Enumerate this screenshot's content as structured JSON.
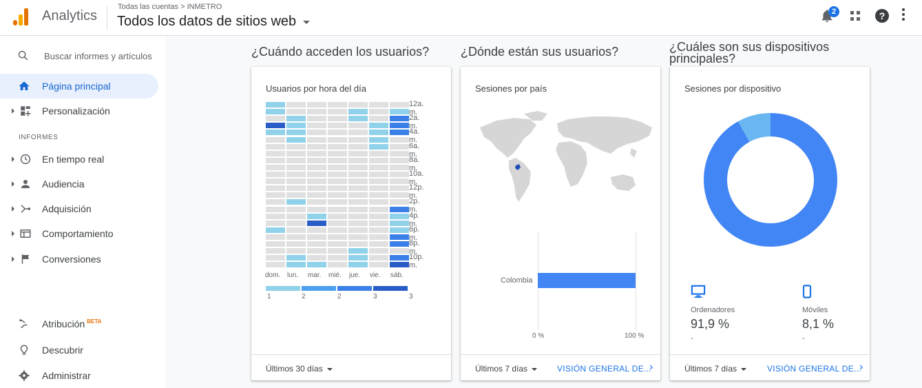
{
  "header": {
    "app_name": "Analytics",
    "breadcrumb": "Todas las cuentas > INMETRO",
    "view_title": "Todos los datos de sitios web",
    "notifications_count": "2"
  },
  "sidebar": {
    "search_placeholder": "Buscar informes y artículos",
    "home": "Página principal",
    "custom": "Personalización",
    "section_reports": "INFORMES",
    "items": [
      {
        "label": "En tiempo real",
        "icon": "clock-icon"
      },
      {
        "label": "Audiencia",
        "icon": "person-icon"
      },
      {
        "label": "Adquisición",
        "icon": "acquisition-icon"
      },
      {
        "label": "Comportamiento",
        "icon": "behavior-icon"
      },
      {
        "label": "Conversiones",
        "icon": "flag-icon"
      }
    ],
    "attribution": "Atribución",
    "attribution_badge": "BETA",
    "discover": "Descubrir",
    "admin": "Administrar"
  },
  "sections": {
    "when": "¿Cuándo acceden los usuarios?",
    "where": "¿Dónde están sus usuarios?",
    "devices": "¿Cuáles son sus dispositivos principales?"
  },
  "cards": {
    "heatmap": {
      "title": "Usuarios por hora del día",
      "range": "Últimos 30 días"
    },
    "geo": {
      "title": "Sesiones por país",
      "range": "Últimos 7 días",
      "link": "VISIÓN GENERAL DE...",
      "country": "Colombia",
      "share": 1.0,
      "tick_min": "0 %",
      "tick_max": "100 %"
    },
    "devices": {
      "title": "Sesiones por dispositivo",
      "range": "Últimos 7 días",
      "link": "VISIÓN GENERAL DE...",
      "desktop_label": "Ordenadores",
      "desktop_pct": "91,9 %",
      "desktop_dash": "-",
      "mobile_label": "Móviles",
      "mobile_pct": "8,1 %",
      "mobile_dash": "-",
      "desktop_share": 0.919,
      "mobile_share": 0.081
    }
  },
  "colors": {
    "accent": "#1a73e8",
    "level1": "#8fd2ea",
    "level2": "#4d9ff0",
    "level3": "#3a80e8",
    "level4": "#2a5cc8",
    "empty": "#e0e0e0",
    "donut_main": "#4285f4",
    "donut_minor": "#6ab6f0"
  },
  "chart_data": {
    "type": "heatmap",
    "title": "Usuarios por hora del día",
    "days": [
      "dom.",
      "lun.",
      "mar.",
      "mié.",
      "jue.",
      "vie.",
      "sáb."
    ],
    "hour_labels": [
      "12a. m.",
      "2a. m.",
      "4a. m.",
      "6a. m.",
      "8a. m.",
      "10a. m.",
      "12p. m.",
      "2p. m.",
      "4p. m.",
      "6p. m.",
      "8p. m.",
      "10p. m."
    ],
    "hour_label_rows": [
      0,
      2,
      4,
      6,
      8,
      10,
      12,
      14,
      16,
      18,
      20,
      22
    ],
    "legend_labels": [
      "1",
      "2",
      "2",
      "3",
      "3"
    ],
    "values": [
      [
        1,
        0,
        0,
        0,
        0,
        0,
        0
      ],
      [
        1,
        0,
        0,
        0,
        1,
        0,
        1
      ],
      [
        0,
        1,
        0,
        0,
        1,
        0,
        3
      ],
      [
        4,
        1,
        0,
        0,
        0,
        1,
        3
      ],
      [
        1,
        1,
        0,
        0,
        0,
        1,
        3
      ],
      [
        0,
        1,
        0,
        0,
        0,
        1,
        0
      ],
      [
        0,
        0,
        0,
        0,
        0,
        1,
        0
      ],
      [
        0,
        0,
        0,
        0,
        0,
        0,
        0
      ],
      [
        0,
        0,
        0,
        0,
        0,
        0,
        0
      ],
      [
        0,
        0,
        0,
        0,
        0,
        0,
        0
      ],
      [
        0,
        0,
        0,
        0,
        0,
        0,
        0
      ],
      [
        0,
        0,
        0,
        0,
        0,
        0,
        0
      ],
      [
        0,
        0,
        0,
        0,
        0,
        0,
        0
      ],
      [
        0,
        0,
        0,
        0,
        0,
        0,
        0
      ],
      [
        0,
        1,
        0,
        0,
        0,
        0,
        0
      ],
      [
        0,
        0,
        0,
        0,
        0,
        0,
        3
      ],
      [
        0,
        0,
        1,
        0,
        0,
        0,
        1
      ],
      [
        0,
        0,
        4,
        0,
        0,
        0,
        1
      ],
      [
        1,
        0,
        0,
        0,
        0,
        0,
        1
      ],
      [
        0,
        0,
        0,
        0,
        0,
        0,
        3
      ],
      [
        0,
        0,
        0,
        0,
        0,
        0,
        3
      ],
      [
        0,
        0,
        0,
        0,
        1,
        0,
        0
      ],
      [
        0,
        1,
        0,
        0,
        1,
        0,
        3
      ],
      [
        0,
        1,
        1,
        0,
        1,
        0,
        4
      ]
    ]
  }
}
